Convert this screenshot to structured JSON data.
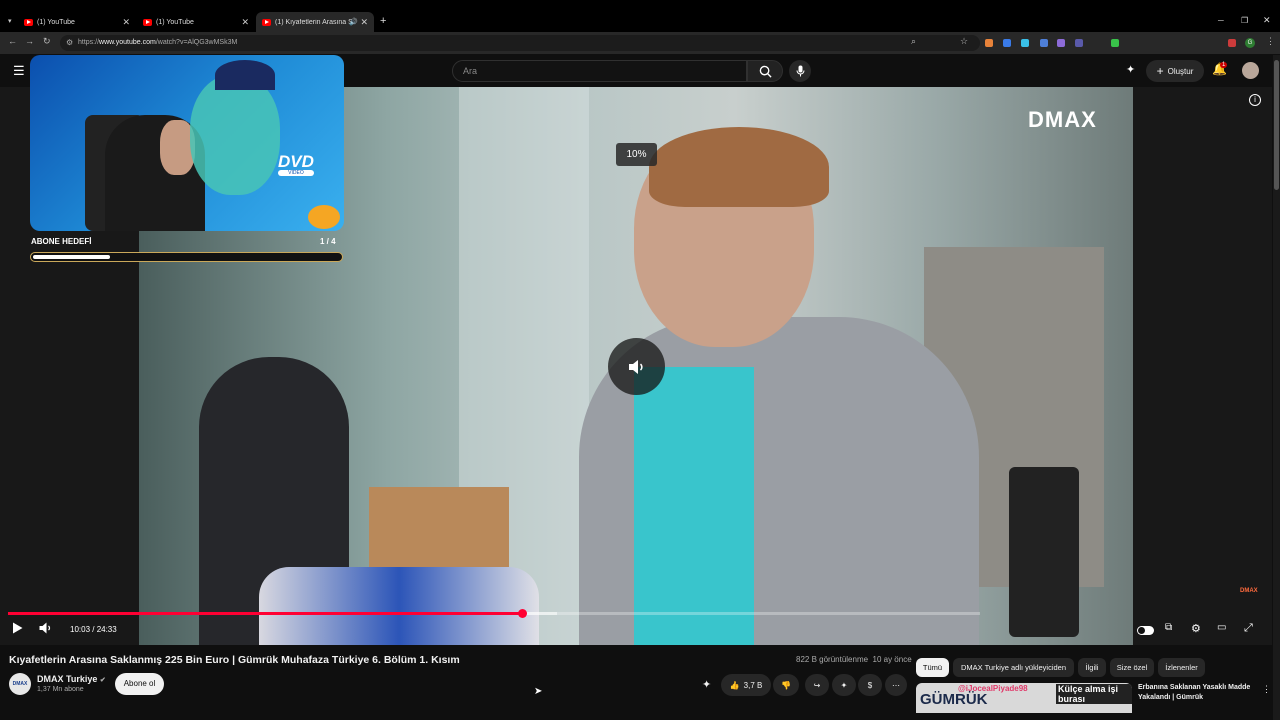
{
  "browser": {
    "tabs": [
      {
        "label": "(1) YouTube"
      },
      {
        "label": "(1) YouTube"
      },
      {
        "label": "(1) Kıyafetlerin Arasına Sakl..."
      }
    ],
    "url_prefix": "https://",
    "url_host": "www.youtube.com",
    "url_path": "/watch?v=AlQG3wMSk3M"
  },
  "header": {
    "search_placeholder": "Ara",
    "create_label": "Oluştur",
    "notif_count": "1"
  },
  "overlay": {
    "goal_label": "ABONE HEDEFİ",
    "goal_count": "1 / 4",
    "goal_progress": 0.25,
    "cam_text": "DVD",
    "cam_subtext": "VIDEO"
  },
  "player": {
    "volume_pct": "10%",
    "channel_logo": "DMAX",
    "corner_logo": "DMAX",
    "time": "10:03 / 24:33",
    "progress": 0.529,
    "buffered": 0.565
  },
  "video": {
    "title": "Kıyafetlerin Arasına Saklanmış 225 Bin Euro | Gümrük Muhafaza Türkiye 6. Bölüm 1. Kısım",
    "views": "822 B görüntülenme",
    "age": "10 ay önce",
    "channel_avatar": "DMAX",
    "channel": "DMAX Turkiye",
    "subscribers": "1,37 Mn abone",
    "subscribe_label": "Abone ol",
    "likes": "3,7 B"
  },
  "chips": [
    {
      "label": "Tümü"
    },
    {
      "label": "DMAX Turkiye adlı yükleyiciden"
    },
    {
      "label": "İlgili"
    },
    {
      "label": "Size özel"
    },
    {
      "label": "İzlenenler"
    }
  ],
  "recommended": {
    "thumb_text": "GÜMRÜK",
    "thumb_overlay": "Külçe alma işi burası",
    "thumb_user": "@iJocealPiyade98",
    "title": "Erbanına Saklanan Yasaklı Madde Yakalandı | Gümrük"
  },
  "colors": {
    "accent": "#ff0033",
    "goal_border": "#caa85a"
  }
}
